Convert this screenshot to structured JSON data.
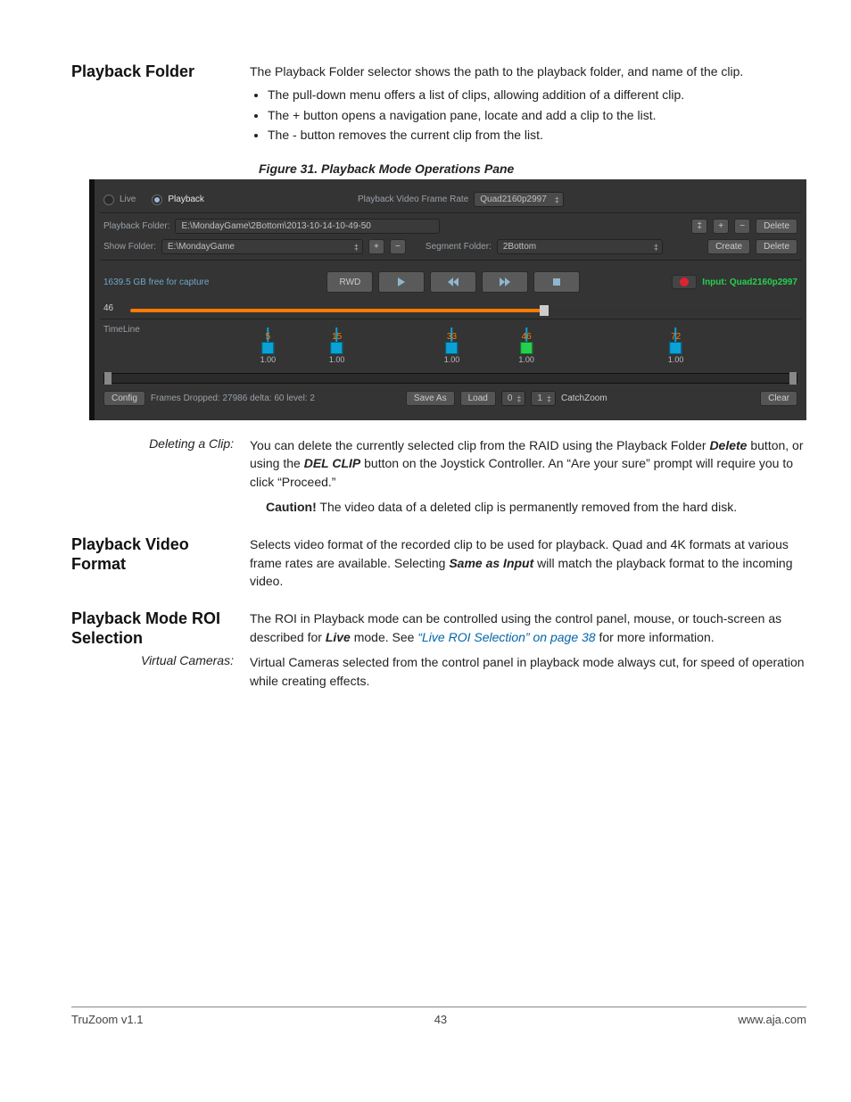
{
  "sections": {
    "playback_folder": {
      "heading": "Playback Folder",
      "intro": "The Playback Folder selector shows the path to the playback folder, and name of the clip.",
      "bullets": [
        "The pull-down menu offers a list of clips, allowing addition of a different clip.",
        "The + button opens a navigation pane, locate and add a clip to the list.",
        "The - button removes the current clip from the list."
      ]
    },
    "deleting": {
      "side": "Deleting a Clip:",
      "p1_a": "You can delete the currently selected clip from the RAID using the Playback Folder ",
      "p1_b": "Delete",
      "p1_c": " button, or using the ",
      "p1_d": "DEL CLIP",
      "p1_e": " button on the Joystick Controller. An “Are your sure” prompt will require you to click “Proceed.”",
      "caution_label": "Caution!",
      "caution_text": " The video data of a deleted clip is permanently removed from the hard disk."
    },
    "video_format": {
      "heading": "Playback Video Format",
      "p_a": "Selects video format of the recorded clip to be used for playback. Quad and 4K formats at various frame rates are available. Selecting ",
      "p_b": "Same as Input",
      "p_c": " will match the playback format to the incoming video."
    },
    "roi": {
      "heading": "Playback Mode ROI Selection",
      "p_a": "The ROI in Playback mode can be controlled using the control panel, mouse, or touch-screen as described for ",
      "p_b": "Live",
      "p_c": " mode. See ",
      "link": "“Live ROI Selection” on page 38",
      "p_d": " for more information."
    },
    "vcam": {
      "side": "Virtual Cameras:",
      "text": "Virtual Cameras selected from the control panel in playback mode always cut, for speed of operation while creating effects."
    }
  },
  "figure_caption": "Figure 31. Playback Mode Operations Pane",
  "ui": {
    "mode": {
      "live": "Live",
      "playback": "Playback"
    },
    "frame_rate_label": "Playback Video Frame Rate",
    "frame_rate_value": "Quad2160p2997",
    "playback_folder_label": "Playback Folder:",
    "playback_folder_value": "E:\\MondayGame\\2Bottom\\2013-10-14-10-49-50",
    "show_folder_label": "Show Folder:",
    "show_folder_value": "E:\\MondayGame",
    "segment_folder_label": "Segment Folder:",
    "segment_folder_value": "2Bottom",
    "btn_plus": "+",
    "btn_minus": "−",
    "btn_delete": "Delete",
    "btn_create": "Create",
    "free_space": "1639.5 GB free for capture",
    "rwd": "RWD",
    "input_label": "Input: Quad2160p2997",
    "scrub": {
      "value": "46",
      "percent": 62
    },
    "timeline_label": "TimeLine",
    "marks": [
      {
        "n": "5",
        "v": "1.00",
        "pct": 10
      },
      {
        "n": "15",
        "v": "1.00",
        "pct": 22
      },
      {
        "n": "33",
        "v": "1.00",
        "pct": 42
      },
      {
        "n": "46",
        "v": "1.00",
        "pct": 55,
        "current": true
      },
      {
        "n": "72",
        "v": "1.00",
        "pct": 81
      }
    ],
    "btn_config": "Config",
    "status": "Frames Dropped: 27986  delta: 60  level: 2",
    "btn_saveas": "Save As",
    "btn_load": "Load",
    "spin_a": "0",
    "spin_b": "1",
    "catchzoom": "CatchZoom",
    "btn_clear": "Clear"
  },
  "footer": {
    "left": "TruZoom v1.1",
    "center": "43",
    "right": "www.aja.com"
  }
}
